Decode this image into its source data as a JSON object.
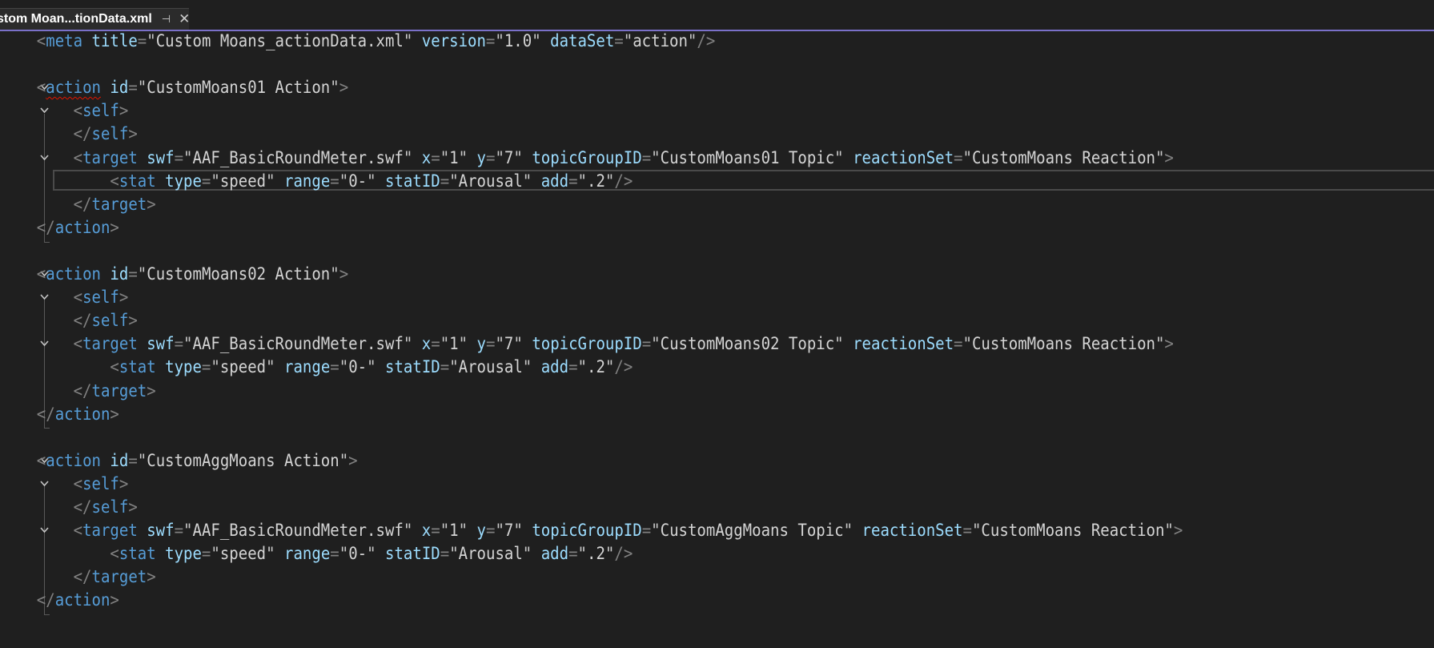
{
  "tab": {
    "title": "stom Moan...tionData.xml"
  },
  "lines": [
    "    <meta title=\"Custom Moans_actionData.xml\" version=\"1.0\" dataSet=\"action\"/>",
    "",
    "    <action id=\"CustomMoans01 Action\">",
    "        <self>",
    "        </self>",
    "        <target swf=\"AAF_BasicRoundMeter.swf\" x=\"1\" y=\"7\" topicGroupID=\"CustomMoans01 Topic\" reactionSet=\"CustomMoans Reaction\">",
    "            <stat type=\"speed\" range=\"0-\" statID=\"Arousal\" add=\".2\"/>",
    "        </target>",
    "    </action>",
    "",
    "    <action id=\"CustomMoans02 Action\">",
    "        <self>",
    "        </self>",
    "        <target swf=\"AAF_BasicRoundMeter.swf\" x=\"1\" y=\"7\" topicGroupID=\"CustomMoans02 Topic\" reactionSet=\"CustomMoans Reaction\">",
    "            <stat type=\"speed\" range=\"0-\" statID=\"Arousal\" add=\".2\"/>",
    "        </target>",
    "    </action>",
    "",
    "    <action id=\"CustomAggMoans Action\">",
    "        <self>",
    "        </self>",
    "        <target swf=\"AAF_BasicRoundMeter.swf\" x=\"1\" y=\"7\" topicGroupID=\"CustomAggMoans Topic\" reactionSet=\"CustomMoans Reaction\">",
    "            <stat type=\"speed\" range=\"0-\" statID=\"Arousal\" add=\".2\"/>",
    "        </target>",
    "    </action>"
  ],
  "colors": {
    "background": "#1f1f1f",
    "tag": "#569cd6",
    "attribute": "#9cdcfe",
    "punctuation": "#808080",
    "value": "#d4d4d4",
    "accent": "#7a70c8",
    "error": "#e51400"
  },
  "icons": {
    "pin": "pin-icon",
    "close": "close-icon",
    "fold": "chevron-down-icon"
  }
}
